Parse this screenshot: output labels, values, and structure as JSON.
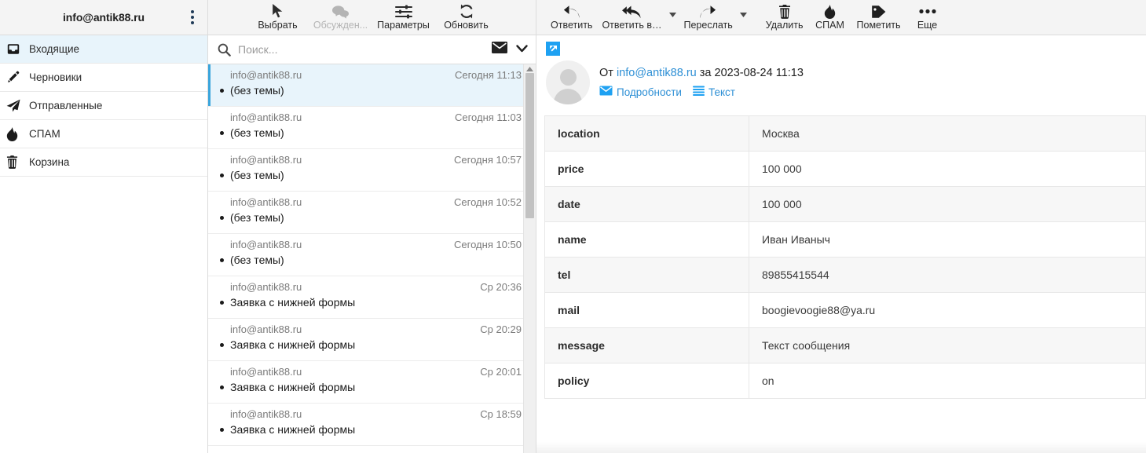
{
  "sidebar": {
    "account": "info@antik88.ru",
    "menu_icon": "kebab-menu-icon",
    "folders": [
      {
        "label": "Входящие",
        "icon": "inbox-icon",
        "active": true
      },
      {
        "label": "Черновики",
        "icon": "pencil-icon",
        "active": false
      },
      {
        "label": "Отправленные",
        "icon": "paper-plane-icon",
        "active": false
      },
      {
        "label": "СПАМ",
        "icon": "fire-icon",
        "active": false
      },
      {
        "label": "Корзина",
        "icon": "trash-icon",
        "active": false
      }
    ]
  },
  "list_toolbar": {
    "buttons": [
      {
        "label": "Выбрать",
        "icon": "cursor-arrow-icon",
        "disabled": false
      },
      {
        "label": "Обсужден...",
        "icon": "chat-bubbles-icon",
        "disabled": true
      },
      {
        "label": "Параметры",
        "icon": "sliders-icon",
        "disabled": false
      },
      {
        "label": "Обновить",
        "icon": "refresh-icon",
        "disabled": false
      }
    ]
  },
  "search": {
    "placeholder": "Поиск...",
    "value": "",
    "icon": "search-icon",
    "scope_icon": "envelope-icon",
    "chevron_icon": "chevron-down-icon"
  },
  "messages": [
    {
      "from": "info@antik88.ru",
      "date": "Сегодня 11:13",
      "subject": "(без темы)",
      "selected": true,
      "unread": true
    },
    {
      "from": "info@antik88.ru",
      "date": "Сегодня 11:03",
      "subject": "(без темы)",
      "selected": false,
      "unread": true
    },
    {
      "from": "info@antik88.ru",
      "date": "Сегодня 10:57",
      "subject": "(без темы)",
      "selected": false,
      "unread": true
    },
    {
      "from": "info@antik88.ru",
      "date": "Сегодня 10:52",
      "subject": "(без темы)",
      "selected": false,
      "unread": true
    },
    {
      "from": "info@antik88.ru",
      "date": "Сегодня 10:50",
      "subject": "(без темы)",
      "selected": false,
      "unread": true
    },
    {
      "from": "info@antik88.ru",
      "date": "Ср 20:36",
      "subject": "Заявка с нижней формы",
      "selected": false,
      "unread": true
    },
    {
      "from": "info@antik88.ru",
      "date": "Ср 20:29",
      "subject": "Заявка с нижней формы",
      "selected": false,
      "unread": true
    },
    {
      "from": "info@antik88.ru",
      "date": "Ср 20:01",
      "subject": "Заявка с нижней формы",
      "selected": false,
      "unread": true
    },
    {
      "from": "info@antik88.ru",
      "date": "Ср 18:59",
      "subject": "Заявка с нижней формы",
      "selected": false,
      "unread": true
    }
  ],
  "read_toolbar": {
    "buttons": [
      {
        "label": "Ответить",
        "icon": "reply-icon",
        "caret": false
      },
      {
        "label": "Ответить в…",
        "icon": "reply-all-icon",
        "caret": true
      },
      {
        "label": "Переслать",
        "icon": "forward-icon",
        "caret": true
      },
      {
        "label": "Удалить",
        "icon": "trash-icon",
        "caret": false
      },
      {
        "label": "СПАМ",
        "icon": "fire-icon",
        "caret": false
      },
      {
        "label": "Пометить",
        "icon": "tag-icon",
        "caret": false
      },
      {
        "label": "Еще",
        "icon": "ellipsis-icon",
        "caret": false
      }
    ]
  },
  "reading": {
    "expand_icon": "expand-arrow-icon",
    "avatar_icon": "user-avatar-icon",
    "from_prefix": "От",
    "from_address": "info@antik88.ru",
    "date_prefix": "за",
    "date": "2023-08-24 11:13",
    "details_label": "Подробности",
    "details_icon": "envelope-icon",
    "text_label": "Текст",
    "text_icon": "lines-icon"
  },
  "body_table": {
    "rows": [
      {
        "key": "location",
        "value": "Москва"
      },
      {
        "key": "price",
        "value": "100 000"
      },
      {
        "key": "date",
        "value": "100 000"
      },
      {
        "key": "name",
        "value": "Иван Иваныч"
      },
      {
        "key": "tel",
        "value": "89855415544"
      },
      {
        "key": "mail",
        "value": "boogievoogie88@ya.ru"
      },
      {
        "key": "message",
        "value": "Текст сообщения"
      },
      {
        "key": "policy",
        "value": "on"
      }
    ]
  },
  "colors": {
    "accent": "#2d8fd5",
    "selected_bg": "#e8f4fb",
    "toolbar_bg": "#f4f4f4",
    "expand_btn": "#1ea1f2"
  }
}
